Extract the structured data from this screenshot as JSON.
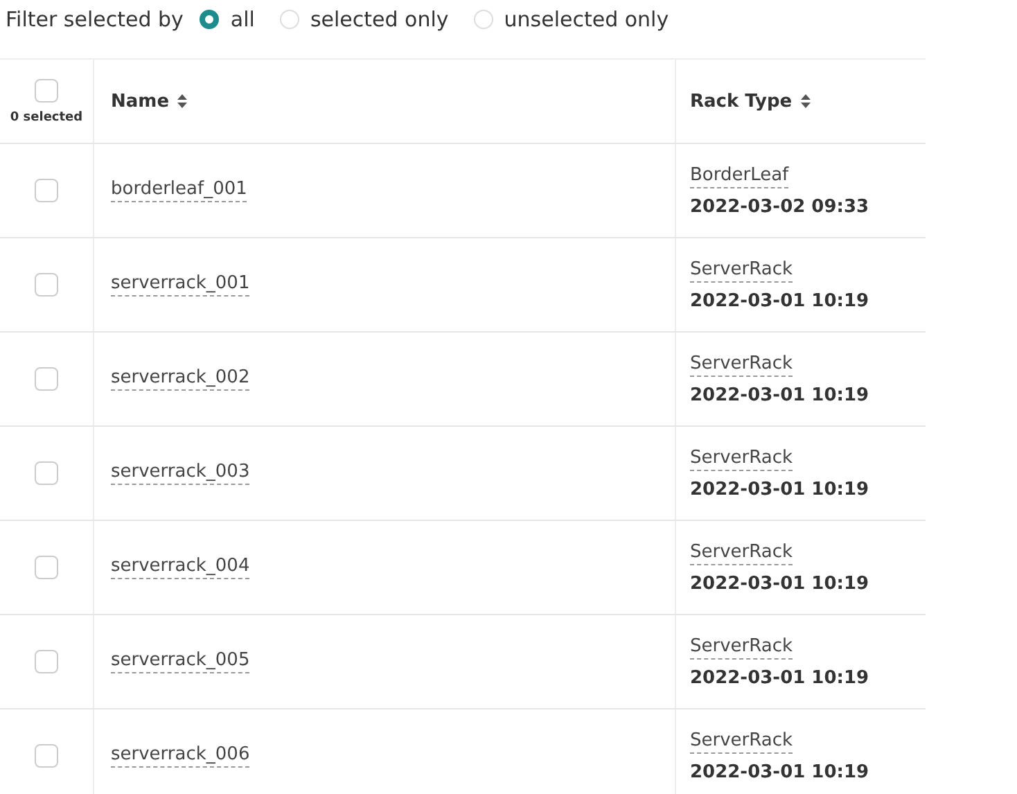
{
  "filter": {
    "label": "Filter selected by",
    "options": [
      {
        "label": "all",
        "selected": true
      },
      {
        "label": "selected only",
        "selected": false
      },
      {
        "label": "unselected only",
        "selected": false
      }
    ]
  },
  "table": {
    "selected_count": "0 selected",
    "select_all_checked": false,
    "columns": [
      {
        "label": "Name",
        "sortable": true
      },
      {
        "label": "Rack Type",
        "sortable": true
      }
    ],
    "rows": [
      {
        "checked": false,
        "name": "borderleaf_001",
        "rack_type": "BorderLeaf",
        "date": "2022-03-02 09:33"
      },
      {
        "checked": false,
        "name": "serverrack_001",
        "rack_type": "ServerRack",
        "date": "2022-03-01 10:19"
      },
      {
        "checked": false,
        "name": "serverrack_002",
        "rack_type": "ServerRack",
        "date": "2022-03-01 10:19"
      },
      {
        "checked": false,
        "name": "serverrack_003",
        "rack_type": "ServerRack",
        "date": "2022-03-01 10:19"
      },
      {
        "checked": false,
        "name": "serverrack_004",
        "rack_type": "ServerRack",
        "date": "2022-03-01 10:19"
      },
      {
        "checked": false,
        "name": "serverrack_005",
        "rack_type": "ServerRack",
        "date": "2022-03-01 10:19"
      },
      {
        "checked": false,
        "name": "serverrack_006",
        "rack_type": "ServerRack",
        "date": "2022-03-01 10:19"
      }
    ]
  }
}
